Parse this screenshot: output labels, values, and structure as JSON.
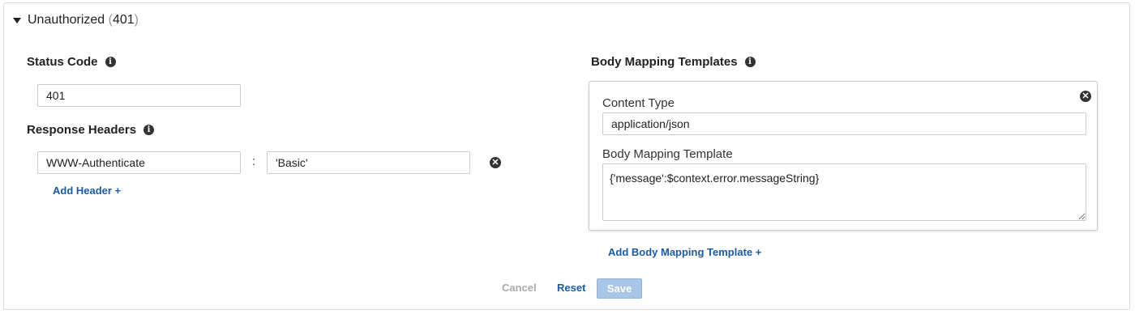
{
  "section": {
    "title": "Unauthorized",
    "code": "401"
  },
  "status_code": {
    "label": "Status Code",
    "value": "401"
  },
  "response_headers": {
    "label": "Response Headers",
    "rows": [
      {
        "name": "WWW-Authenticate",
        "separator": ":",
        "value": "'Basic'"
      }
    ],
    "add_label": "Add Header +"
  },
  "body_mapping": {
    "label": "Body Mapping Templates",
    "content_type_label": "Content Type",
    "content_type_value": "application/json",
    "template_label": "Body Mapping Template",
    "template_value": "{'message':$context.error.messageString}",
    "add_label": "Add Body Mapping Template +"
  },
  "actions": {
    "cancel": "Cancel",
    "reset": "Reset",
    "save": "Save"
  },
  "icons": {
    "info": "info-icon",
    "remove": "remove-icon",
    "caret": "caret-down-icon"
  },
  "colors": {
    "link": "#1a5aa6",
    "save_disabled": "#a9c6e6"
  }
}
